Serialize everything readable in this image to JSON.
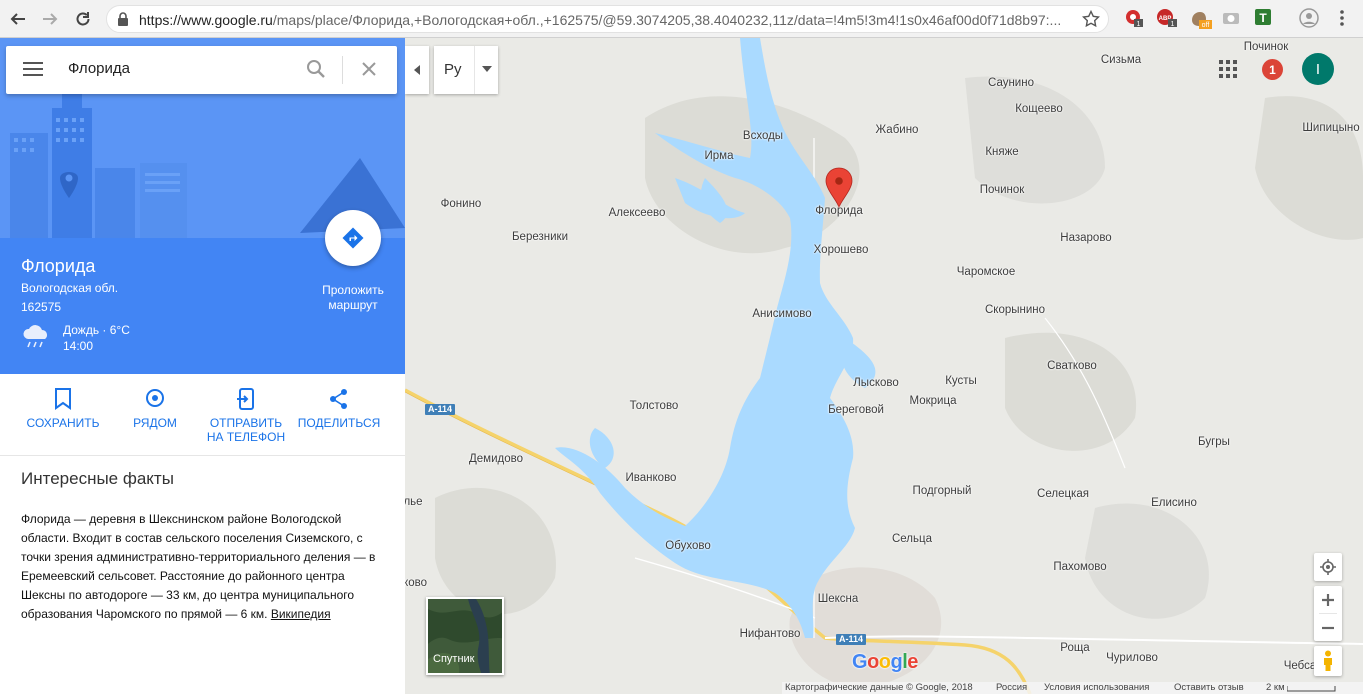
{
  "browser": {
    "url_host": "https://www.google.ru",
    "url_path": "/maps/place/Флорида,+Вологодская+обл.,+162575/@59.3074205,38.4040232,11z/data=!4m5!3m4!1s0x46af00d0f71d8b97:...",
    "ext_badges": [
      "1",
      "1",
      "off"
    ]
  },
  "search": {
    "query": "Флорида"
  },
  "place": {
    "title": "Флорида",
    "region": "Вологодская обл.",
    "postcode": "162575",
    "weather": "Дождь · 6°C",
    "weather_time": "14:00",
    "directions_label": "Проложить маршрут"
  },
  "actions": [
    {
      "label": "СОХРАНИТЬ"
    },
    {
      "label": "РЯДОМ"
    },
    {
      "label": "ОТПРАВИТЬ НА ТЕЛЕФОН"
    },
    {
      "label": "ПОДЕЛИТЬСЯ"
    }
  ],
  "facts": {
    "title": "Интересные факты",
    "text": "Флорида — деревня в Шекснинском районе Вологодской области. Входит в состав сельского поселения Сиземского, с точки зрения административно-территориального деления — в Еремеевский сельсовет. Расстояние до районного центра Шексны по автодороге — 33 км, до центра муниципального образования Чаромского по прямой — 6 км. ",
    "link": "Википедия"
  },
  "map": {
    "lang": "Ру",
    "notifications": "1",
    "avatar_letter": "I",
    "satellite_label": "Спутник",
    "logo": "Google",
    "road_labels": [
      "А-114",
      "А-114"
    ],
    "places": [
      "Починок",
      "Сизьма",
      "Саунино",
      "Кощеево",
      "Шипицыно",
      "Жабино",
      "Всходы",
      "Ирма",
      "Княже",
      "Флорида",
      "Починок",
      "Фонино",
      "Алексеево",
      "Березники",
      "Назарово",
      "Хорошево",
      "Чаромское",
      "Анисимово",
      "Скорынино",
      "Сватково",
      "Кусты",
      "Лысково",
      "Береговой",
      "Мокрица",
      "Толстово",
      "Бугры",
      "Демидово",
      "Иванково",
      "Подгорный",
      "Селецкая",
      "Елисино",
      "льe",
      "Обухово",
      "Сельца",
      "Пахомово",
      "ково",
      "Шексна",
      "Нифантово",
      "Роща",
      "Чурилово",
      "Чебса"
    ],
    "footer": {
      "data": "Картографические данные © Google, 2018",
      "country": "Россия",
      "terms": "Условия использования",
      "feedback": "Оставить отзыв",
      "scale": "2 км"
    }
  },
  "colors": {
    "accent": "#4285f4",
    "water": "#aadaff",
    "pin": "#ea4335",
    "road": "#f5d36b",
    "land": "#eaeae6"
  }
}
